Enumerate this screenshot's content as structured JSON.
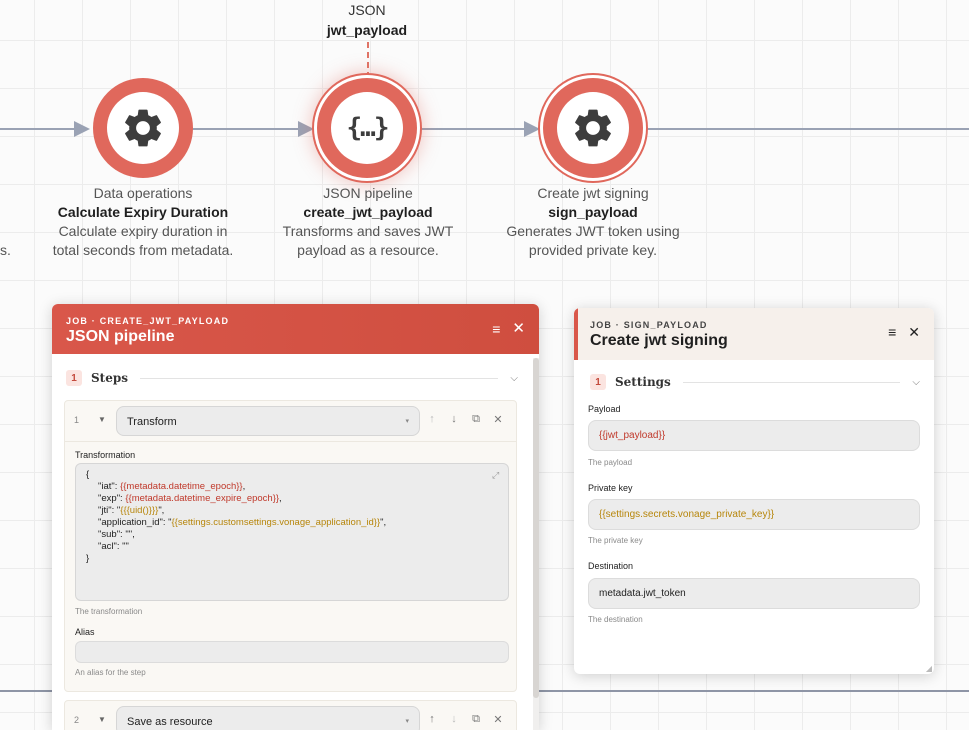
{
  "canvas": {
    "top_node": {
      "type": "JSON",
      "title": "jwt_payload"
    },
    "nodes": [
      {
        "type": "Data operations",
        "title": "Calculate Expiry Duration",
        "desc1": "Calculate expiry duration in",
        "desc2": "total seconds from metadata."
      },
      {
        "type": "JSON pipeline",
        "title": "create_jwt_payload",
        "desc1": "Transforms and saves JWT",
        "desc2": "payload as a resource."
      },
      {
        "type": "Create jwt signing",
        "title": "sign_payload",
        "desc1": "Generates JWT token using",
        "desc2": "provided private key."
      }
    ],
    "left_cut_text": "s.",
    "icons": {
      "gear": "gear-icon",
      "braces": "braces-icon"
    }
  },
  "panel_json": {
    "crumb": "JOB · CREATE_JWT_PAYLOAD",
    "title": "JSON pipeline",
    "section": {
      "number": "1",
      "label": "Steps"
    },
    "steps": [
      {
        "number": "1",
        "selected": "Transform"
      },
      {
        "number": "2",
        "selected": "Save as resource"
      }
    ],
    "transformation": {
      "label": "Transformation",
      "hint": "The transformation",
      "lines": {
        "l1": "{",
        "l2_key": "\"iat\": ",
        "l2_val": "{{metadata.datetime_epoch}}",
        "l2_end": ",",
        "l3_key": "\"exp\": ",
        "l3_val": "{{metadata.datetime_expire_epoch}}",
        "l3_end": ",",
        "l4_key": "\"jti\": \"",
        "l4_val": "{{{uid()}}}",
        "l4_end": "\",",
        "l5_key": "\"application_id\": \"",
        "l5_val": "{{settings.customsettings.vonage_application_id}}",
        "l5_end": "\",",
        "l6": "\"sub\": \"\",",
        "l7": "\"acl\": \"\"",
        "l8": "}"
      }
    },
    "alias": {
      "label": "Alias",
      "value": "",
      "hint": "An alias for the step"
    }
  },
  "panel_sign": {
    "crumb": "JOB · SIGN_PAYLOAD",
    "title": "Create jwt signing",
    "section": {
      "number": "1",
      "label": "Settings"
    },
    "payload": {
      "label": "Payload",
      "value": "{{jwt_payload}}",
      "hint": "The payload"
    },
    "private_key": {
      "label": "Private key",
      "value": "{{settings.secrets.vonage_private_key}}",
      "hint": "The private key"
    },
    "destination": {
      "label": "Destination",
      "value": "metadata.jwt_token",
      "hint": "The destination"
    }
  },
  "colors": {
    "accent": "#d9574a",
    "node": "#e0685c",
    "edge": "#9aa2b4",
    "template_red": "#c0392b",
    "template_gold": "#b7860b"
  }
}
